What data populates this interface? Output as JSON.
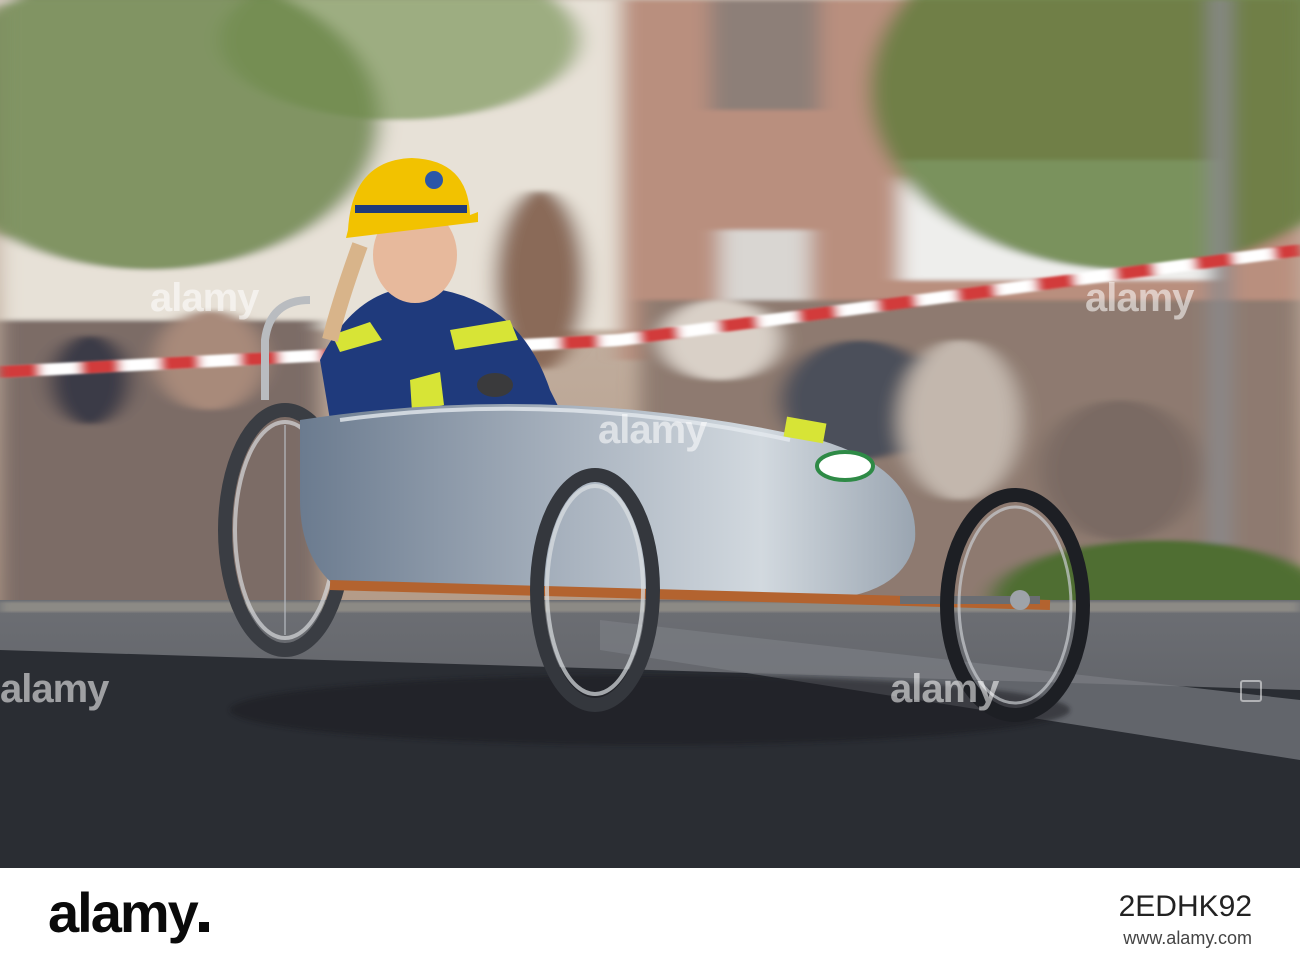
{
  "photo": {
    "icon": "photo-icon",
    "colors": {
      "asphalt": "#3c3f45",
      "shadow": "#1f2227",
      "building": "#c7a896",
      "helmet": "#f2c200",
      "jacket": "#1e3a7a",
      "reflective": "#d7e436",
      "car_body": "#a9b2bd"
    }
  },
  "watermarks": {
    "text": "alamy"
  },
  "footer": {
    "logo_text": "alamy",
    "image_id": "2EDHK92",
    "image_url": "www.alamy.com"
  }
}
